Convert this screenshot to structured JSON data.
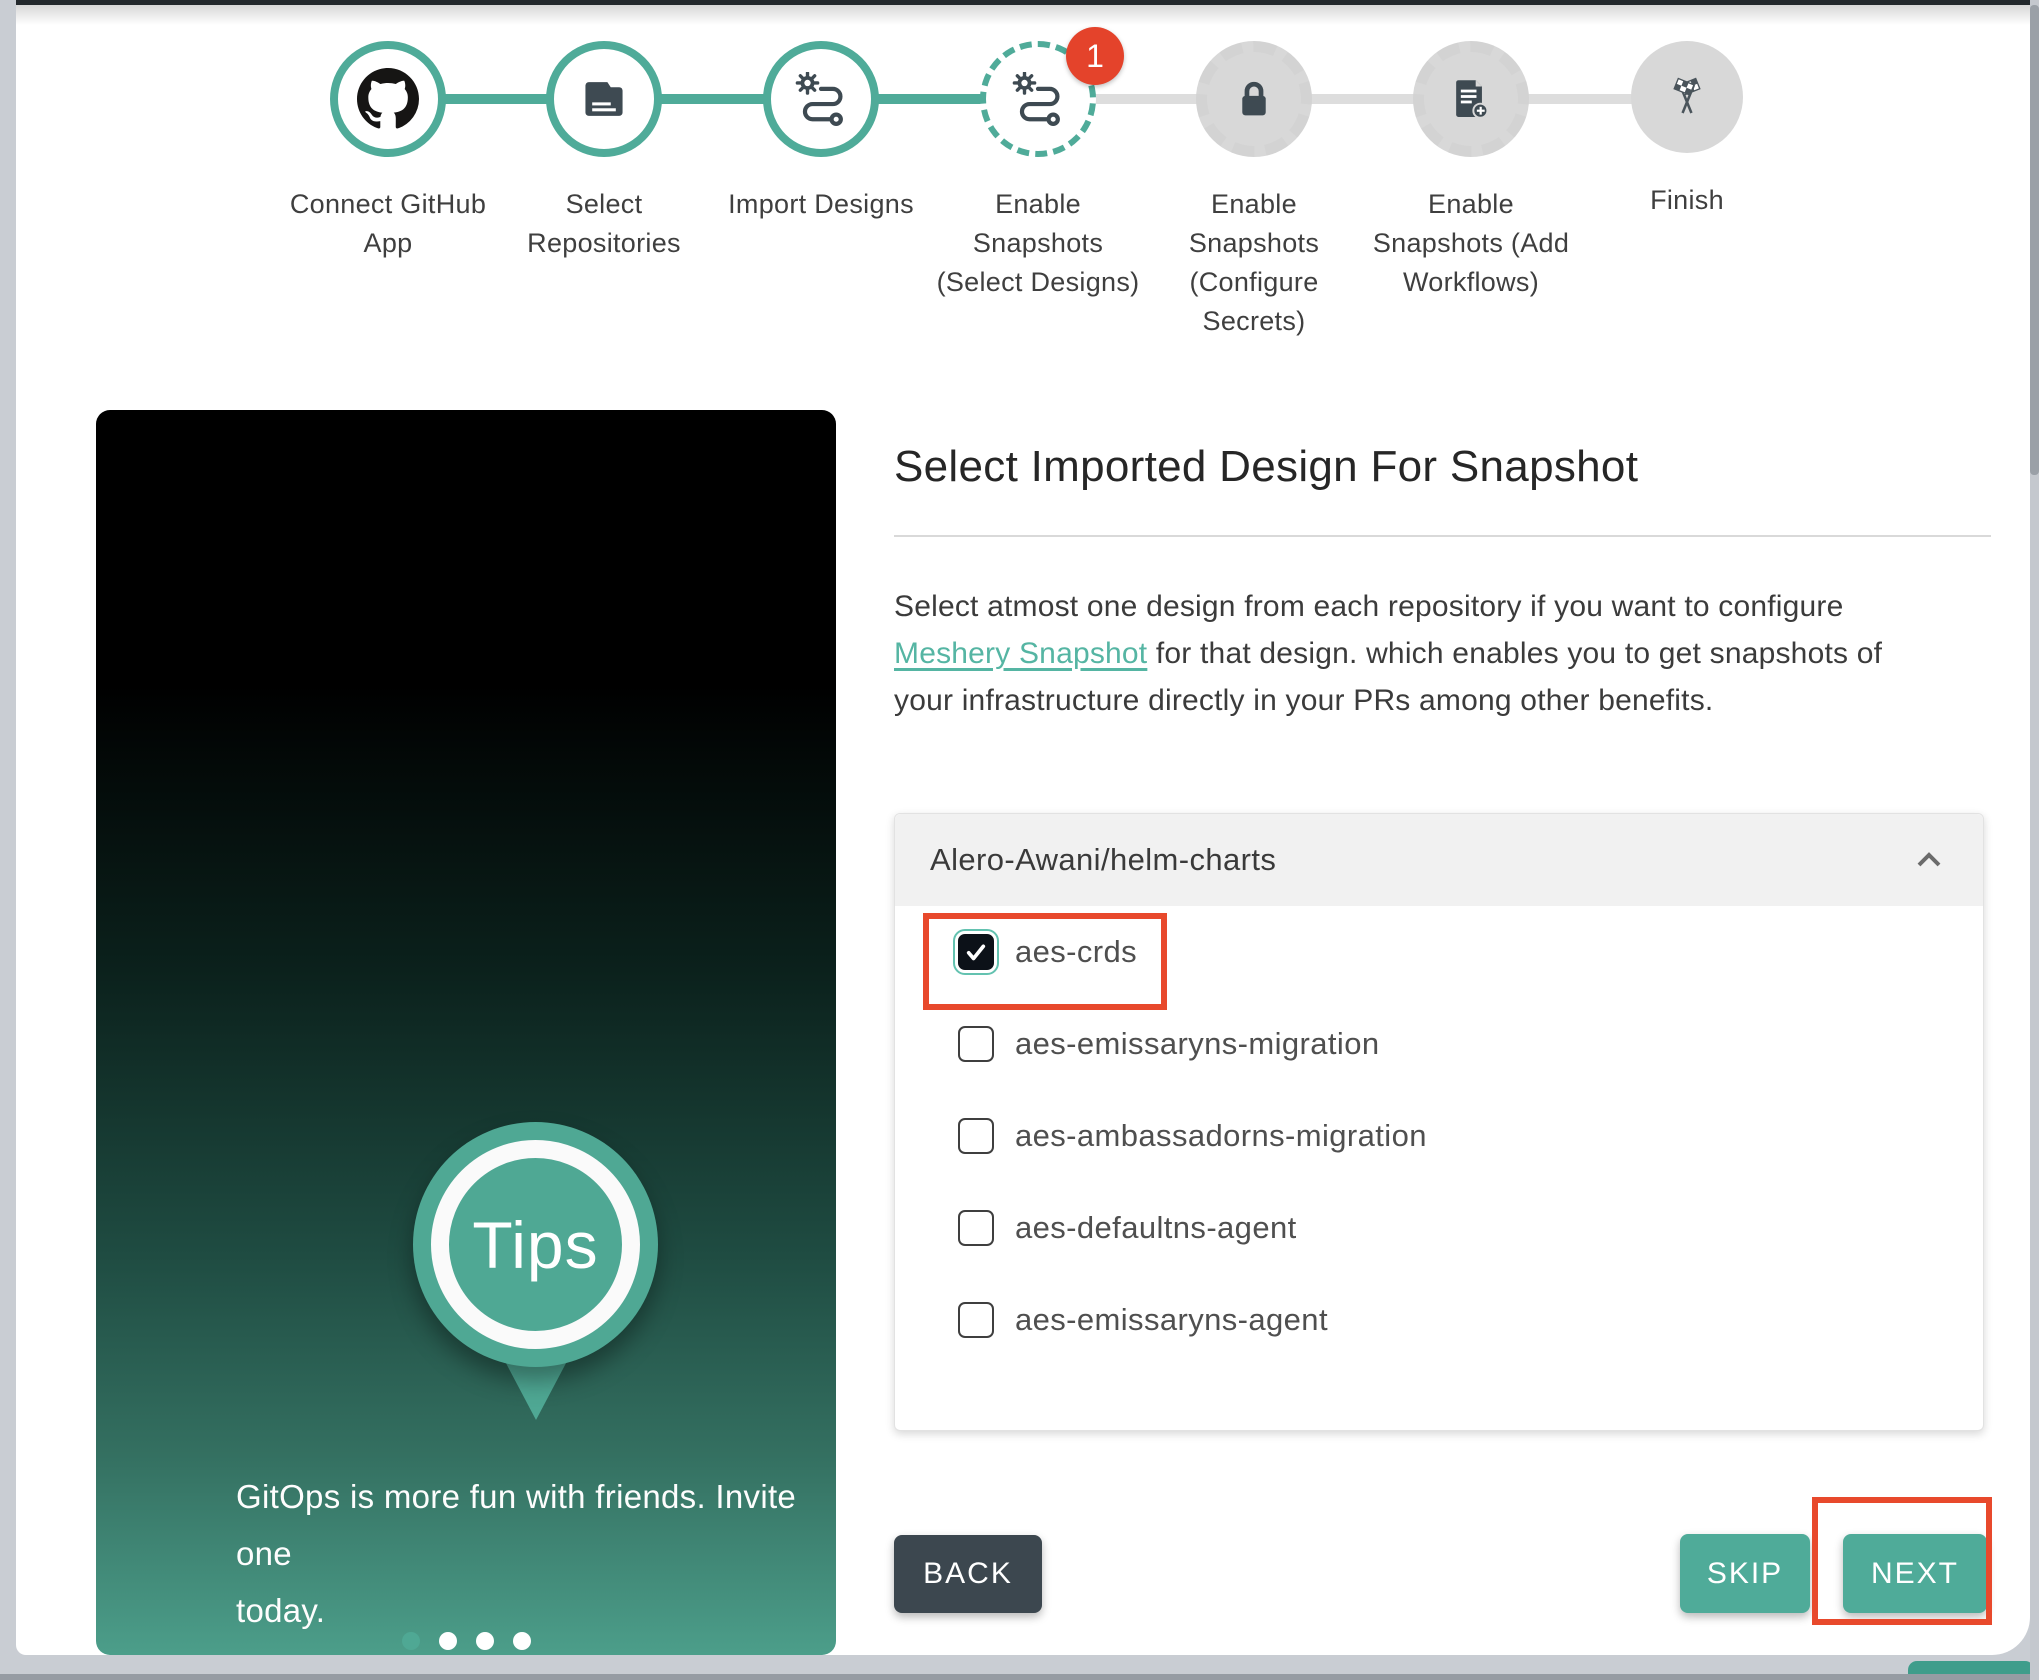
{
  "stepper": {
    "steps": [
      {
        "label": "Connect GitHub\nApp",
        "state": "completed",
        "icon": "github-icon"
      },
      {
        "label": "Select\nRepositories",
        "state": "completed",
        "icon": "repository-icon"
      },
      {
        "label": "Import Designs",
        "state": "completed",
        "icon": "route-icon"
      },
      {
        "label": "Enable\nSnapshots\n(Select Designs)",
        "state": "active",
        "icon": "route-icon",
        "badge": "1"
      },
      {
        "label": "Enable\nSnapshots\n(Configure\nSecrets)",
        "state": "upcoming",
        "icon": "lock-icon"
      },
      {
        "label": "Enable\nSnapshots (Add\nWorkflows)",
        "state": "upcoming",
        "icon": "document-add-icon"
      },
      {
        "label": "Finish",
        "state": "upcoming",
        "icon": "finish-flags-icon"
      }
    ]
  },
  "tips": {
    "badge_title": "Tips",
    "message": "GitOps is more fun with friends. Invite one\ntoday.",
    "carousel_dot_count": 4,
    "active_dot_index": 0
  },
  "content": {
    "heading": "Select Imported Design For Snapshot",
    "description": {
      "before_link": "Select atmost one design from each repository if you want to configure ",
      "link_text": "Meshery Snapshot",
      "after_link": " for that design. which enables you to get snapshots of your infrastructure directly in your PRs among other benefits."
    },
    "repository": {
      "name": "Alero-Awani/helm-charts",
      "expanded": true,
      "designs": [
        {
          "label": "aes-crds",
          "checked": true,
          "annotated": true
        },
        {
          "label": "aes-emissaryns-migration",
          "checked": false
        },
        {
          "label": "aes-ambassadorns-migration",
          "checked": false
        },
        {
          "label": "aes-defaultns-agent",
          "checked": false
        },
        {
          "label": "aes-emissaryns-agent",
          "checked": false
        }
      ]
    },
    "actions": {
      "back": "BACK",
      "skip": "SKIP",
      "next": "NEXT"
    }
  },
  "annotations": [
    "selected-design-checkbox",
    "next-button"
  ],
  "colors": {
    "teal": "#4fab99",
    "link_teal": "#55b5a3",
    "annotation_red": "#e8492c",
    "badge_red": "#e4432b",
    "dark_button": "#3c474f",
    "pending_gray": "#d8d8d8",
    "page_background": "#c9cdd3"
  }
}
